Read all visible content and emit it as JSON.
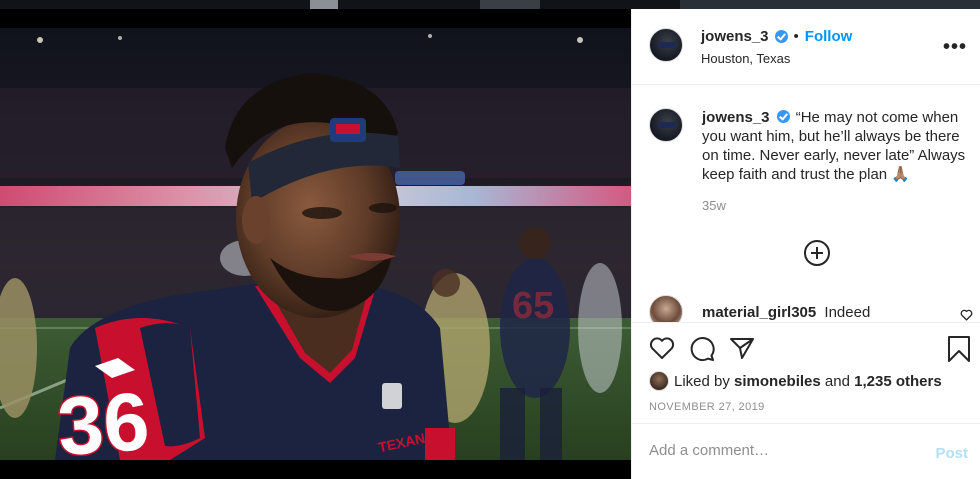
{
  "post_header": {
    "username": "jowens_3",
    "separator": "•",
    "follow_label": "Follow",
    "location": "Houston, Texas",
    "more_icon": "more-horizontal-icon"
  },
  "caption": {
    "username": "jowens_3",
    "text": "“He may not come when you want him, but he’ll always be there on time. Never early, never late” Always keep faith and trust the plan 🙏🏽",
    "age": "35w"
  },
  "comments": [
    {
      "username": "material_girl305",
      "text": "Indeed"
    }
  ],
  "likes": {
    "prefix": "Liked by",
    "user": "simonebiles",
    "conjunction": "and",
    "others": "1,235 others"
  },
  "post_date": "NOVEMBER 27, 2019",
  "comment_input": {
    "placeholder": "Add a comment…",
    "post_label": "Post"
  },
  "colors": {
    "accent": "#0095f6",
    "verified": "#3897f0",
    "post_disabled": "#b2dffc",
    "jersey_navy": "#1b2340",
    "jersey_red": "#c8102e"
  },
  "photo": {
    "jersey_number": "36",
    "back_jersey_number": "65",
    "jersey_wordmark": "TEXANS"
  }
}
